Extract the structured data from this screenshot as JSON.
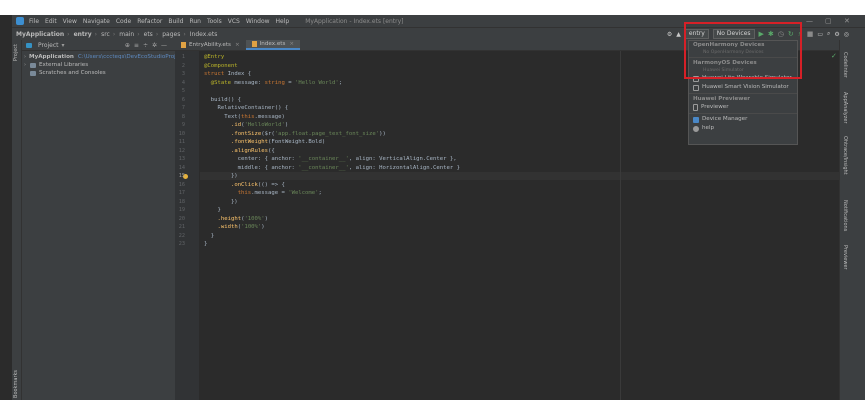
{
  "window": {
    "menu": [
      "File",
      "Edit",
      "View",
      "Navigate",
      "Code",
      "Refactor",
      "Build",
      "Run",
      "Tools",
      "VCS",
      "Window",
      "Help"
    ],
    "title": "MyApplication - Index.ets [entry]",
    "controls": [
      "—",
      "▢",
      "✕"
    ]
  },
  "navbar": {
    "breadcrumb": [
      "MyApplication",
      "entry",
      "src",
      "main",
      "ets",
      "pages",
      "Index.ets"
    ],
    "config": "entry",
    "device": "No Devices"
  },
  "left_strip": {
    "top": "Project",
    "bottom": "Bookmarks"
  },
  "project": {
    "title": "Project",
    "tree": [
      {
        "label": "MyApplication",
        "path": "C:\\Users\\cccteqs\\DevEcoStudioProje",
        "kind": "project"
      },
      {
        "label": "External Libraries",
        "kind": "library"
      },
      {
        "label": "Scratches and Consoles",
        "kind": "scratch"
      }
    ]
  },
  "tabs": [
    {
      "label": "EntryAbility.ets",
      "active": false
    },
    {
      "label": "Index.ets",
      "active": true
    }
  ],
  "code": [
    {
      "n": "1",
      "text": "@Entry"
    },
    {
      "n": "2",
      "text": "@Component"
    },
    {
      "n": "3",
      "text": "struct Index {"
    },
    {
      "n": "4",
      "text": "  @State message: string = 'Hello World';"
    },
    {
      "n": "5",
      "text": ""
    },
    {
      "n": "6",
      "text": "  build() {"
    },
    {
      "n": "7",
      "text": "    RelativeContainer() {"
    },
    {
      "n": "8",
      "text": "      Text(this.message)"
    },
    {
      "n": "9",
      "text": "        .id('HelloWorld')"
    },
    {
      "n": "10",
      "text": "        .fontSize($r('app.float.page_text_font_size'))"
    },
    {
      "n": "11",
      "text": "        .fontWeight(FontWeight.Bold)"
    },
    {
      "n": "12",
      "text": "        .alignRules({"
    },
    {
      "n": "13",
      "text": "          center: { anchor: '__container__', align: VerticalAlign.Center },"
    },
    {
      "n": "14",
      "text": "          middle: { anchor: '__container__', align: HorizontalAlign.Center }"
    },
    {
      "n": "15",
      "text": "        })"
    },
    {
      "n": "16",
      "text": "        .onClick(() => {"
    },
    {
      "n": "17",
      "text": "          this.message = 'Welcome';"
    },
    {
      "n": "18",
      "text": "        })"
    },
    {
      "n": "19",
      "text": "    }"
    },
    {
      "n": "20",
      "text": "    .height('100%')"
    },
    {
      "n": "21",
      "text": "    .width('100%')"
    },
    {
      "n": "22",
      "text": "  }"
    },
    {
      "n": "23",
      "text": "}"
    }
  ],
  "current_line": "15",
  "right_strip": [
    "Codelinter",
    "AppAnalyzer",
    "Ohtrace/Insight",
    "Notifications",
    "Previewer"
  ],
  "device_dropdown": {
    "groups": [
      {
        "header": "OpenHarmony Devices",
        "items": [
          {
            "label": "No OpenHarmony Devices",
            "kind": "sub"
          }
        ]
      },
      {
        "header": "HarmonyOS Devices",
        "items": [
          {
            "label": "Huawei Simulator",
            "kind": "sub"
          },
          {
            "label": "Huawei Lite Wearable Simulator",
            "kind": "item",
            "icon": "watch-icon"
          },
          {
            "label": "Huawei Smart Vision Simulator",
            "kind": "item",
            "icon": "tv-icon"
          }
        ]
      },
      {
        "header": "Huawei Previewer",
        "items": [
          {
            "label": "Previewer",
            "kind": "item",
            "icon": "phone-icon"
          }
        ]
      }
    ],
    "actions": [
      {
        "label": "Device Manager",
        "icon": "device-manager-icon"
      },
      {
        "label": "help",
        "icon": "help-icon"
      }
    ]
  },
  "colors": {
    "highlight": "#d62027",
    "accent": "#4a88c7",
    "run": "#59a869"
  }
}
